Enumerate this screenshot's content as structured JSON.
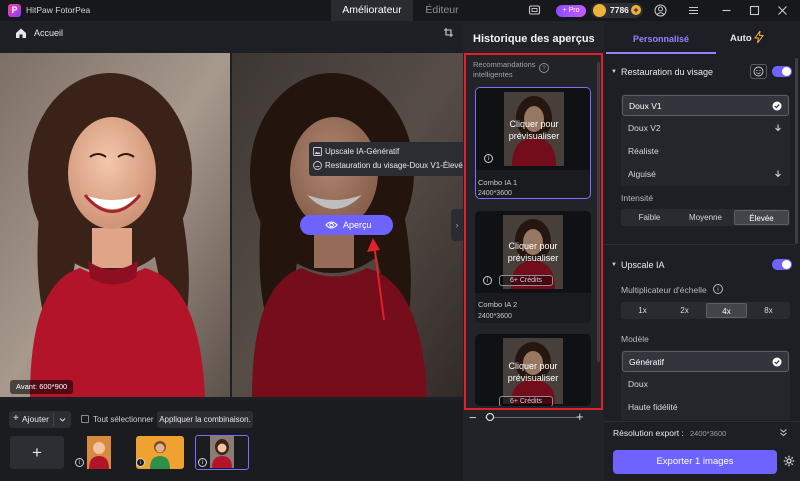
{
  "app": {
    "logo_letter": "P",
    "name": "HitPaw FotorPea"
  },
  "tabs": {
    "enhancer": "Améliorateur",
    "editor": "Éditeur"
  },
  "account": {
    "pro_label": "+ Pro",
    "credits": "7786",
    "credit_plus": "+"
  },
  "home": {
    "label": "Accueil"
  },
  "preview": {
    "size_badge": "Avant: 600*900",
    "tooltip_line1": "Upscale IA-Génératif",
    "tooltip_line2": "Restauration du visage-Doux V1-Élevée",
    "apercu_button": "Aperçu",
    "handle_glyph": "›"
  },
  "bottom": {
    "add_label": "Ajouter",
    "add_plus": "+",
    "select_all": "Tout sélectionner",
    "apply_combo": "Appliquer la combinaison.",
    "add_tile_glyph": "+",
    "info_glyph": "i"
  },
  "history": {
    "title": "Historique des aperçus",
    "reco_label": "Recommandations intelligentes",
    "help_glyph": "?",
    "cards": [
      {
        "click_line1": "Cliquer pour",
        "click_line2": "prévisualiser",
        "name": "Combo IA 1",
        "res": "2400*3600"
      },
      {
        "click_line1": "Cliquer pour",
        "click_line2": "prévisualiser",
        "credits": "6+ Crédits",
        "name": "Combo IA 2",
        "res": "2400*3600"
      },
      {
        "click_line1": "Cliquer pour",
        "click_line2": "prévisualiser",
        "credits": "6+ Crédits"
      }
    ],
    "zoom_minus": "−",
    "zoom_plus": "+"
  },
  "settings": {
    "tab_custom": "Personnalisé",
    "tab_auto": "Auto",
    "face": {
      "title": "Restauration du visage",
      "enabled": true,
      "models": [
        "Doux V1",
        "Doux V2",
        "Réaliste",
        "Aiguisé"
      ],
      "selected_model": "Doux V1",
      "intensity_label": "Intensité",
      "intensity_options": [
        "Faible",
        "Moyenne",
        "Élevée"
      ],
      "selected_intensity": "Élevée"
    },
    "upscale": {
      "title": "Upscale IA",
      "enabled": true,
      "multiplier_label": "Multiplicateur d'échelle",
      "multiplier_options": [
        "1x",
        "2x",
        "4x",
        "8x"
      ],
      "selected_multiplier": "4x",
      "model_label": "Modèle",
      "models": [
        "Génératif",
        "Doux",
        "Haute fidélité"
      ],
      "selected_model": "Génératif"
    },
    "export_label": "Résolution export :",
    "export_value": "2400*3600",
    "export_button": "Exporter 1 images"
  },
  "colors": {
    "accent": "#6e63ff",
    "highlight_red": "#e1202b",
    "dress_red": "#b3142a"
  },
  "caret_glyph": "▼"
}
